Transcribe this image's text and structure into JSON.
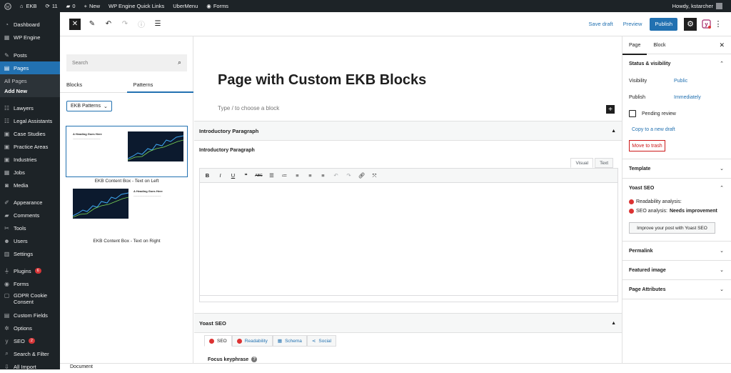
{
  "admin_bar": {
    "site_name": "EKB",
    "updates_count": "11",
    "comments_count": "0",
    "new_label": "New",
    "wpengine_links": "WP Engine Quick Links",
    "ubermenu": "UberMenu",
    "forms": "Forms",
    "greeting": "Howdy, kstarcher"
  },
  "sidebar": {
    "items": [
      {
        "label": "Dashboard",
        "icon": "dashboard-icon"
      },
      {
        "label": "WP Engine",
        "icon": "wpengine-icon"
      },
      {
        "label": "Posts",
        "icon": "pin-icon"
      },
      {
        "label": "Pages",
        "icon": "pages-icon"
      },
      {
        "label": "Lawyers",
        "icon": "people-icon"
      },
      {
        "label": "Legal Assistants",
        "icon": "people-icon"
      },
      {
        "label": "Case Studies",
        "icon": "portfolio-icon"
      },
      {
        "label": "Practice Areas",
        "icon": "portfolio-icon"
      },
      {
        "label": "Industries",
        "icon": "portfolio-icon"
      },
      {
        "label": "Jobs",
        "icon": "calendar-icon"
      },
      {
        "label": "Media",
        "icon": "media-icon"
      },
      {
        "label": "Appearance",
        "icon": "brush-icon"
      },
      {
        "label": "Comments",
        "icon": "comment-icon"
      },
      {
        "label": "Tools",
        "icon": "wrench-icon"
      },
      {
        "label": "Users",
        "icon": "user-icon"
      },
      {
        "label": "Settings",
        "icon": "settings-icon"
      },
      {
        "label": "Plugins",
        "icon": "plug-icon",
        "badge": "6"
      },
      {
        "label": "Forms",
        "icon": "forms-icon"
      },
      {
        "label": "GDPR Cookie Consent",
        "icon": "cookie-icon"
      },
      {
        "label": "Custom Fields",
        "icon": "fields-icon"
      },
      {
        "label": "Options",
        "icon": "gear-icon"
      },
      {
        "label": "SEO",
        "icon": "yoast-icon",
        "badge": "2"
      },
      {
        "label": "Search & Filter",
        "icon": "search-icon"
      },
      {
        "label": "All Import",
        "icon": "import-icon"
      }
    ],
    "pages_submenu": [
      "All Pages",
      "Add New"
    ]
  },
  "toolbar": {
    "save_draft": "Save draft",
    "preview": "Preview",
    "publish": "Publish"
  },
  "inserter": {
    "search_placeholder": "Search",
    "tabs": [
      "Blocks",
      "Patterns"
    ],
    "category": "EKB Patterns",
    "patterns": [
      {
        "label": "EKB Content Box - Text on Left",
        "heading": "A Heading Goes Here"
      },
      {
        "label": "EKB Content Box - Text on Right",
        "heading": "A Heading Goes Here"
      }
    ]
  },
  "canvas": {
    "title": "Page with Custom EKB Blocks",
    "appender": "Type / to choose a block",
    "intro_box_title": "Introductory Paragraph",
    "intro_field_label": "Introductory Paragraph",
    "visual_tab": "Visual",
    "text_tab": "Text",
    "yoast_box_title": "Yoast SEO",
    "yoast_tabs": [
      "SEO",
      "Readability",
      "Schema",
      "Social"
    ],
    "focus_keyphrase": "Focus keyphrase"
  },
  "settings_panel": {
    "tabs": [
      "Page",
      "Block"
    ],
    "status_title": "Status & visibility",
    "visibility_label": "Visibility",
    "visibility_value": "Public",
    "publish_label": "Publish",
    "publish_value": "Immediately",
    "pending_review": "Pending review",
    "copy_draft": "Copy to a new draft",
    "move_trash": "Move to trash",
    "template": "Template",
    "yoast_title": "Yoast SEO",
    "readability": "Readability analysis:",
    "seo_analysis": "SEO analysis:",
    "seo_status": "Needs improvement",
    "improve_btn": "Improve your post with Yoast SEO",
    "permalink": "Permalink",
    "featured_image": "Featured image",
    "page_attributes": "Page Attributes"
  },
  "footer": {
    "breadcrumb": "Document"
  },
  "colors": {
    "accent": "#2271b1",
    "admin_bg": "#1d2327",
    "danger": "#cc1818",
    "error_dot": "#dc3232"
  }
}
